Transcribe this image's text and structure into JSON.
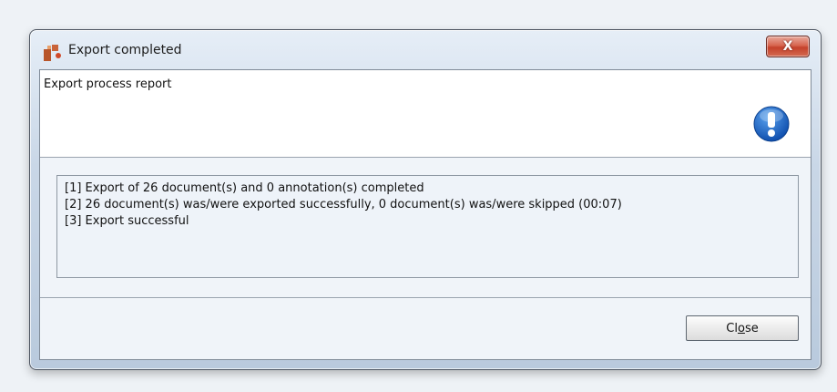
{
  "window": {
    "title": "Export completed",
    "close_glyph": "X"
  },
  "header": {
    "text": "Export process report",
    "icon": "exclamation-info-icon",
    "icon_color": "#1a66c8"
  },
  "report": {
    "lines": [
      "[1] Export of 26 document(s) and 0 annotation(s) completed",
      "[2] 26 document(s) was/were exported successfully, 0 document(s) was/were skipped (00:07)",
      "[3] Export successful"
    ]
  },
  "footer": {
    "close_label_pre": "Cl",
    "close_label_mnemonic": "o",
    "close_label_post": "se"
  }
}
